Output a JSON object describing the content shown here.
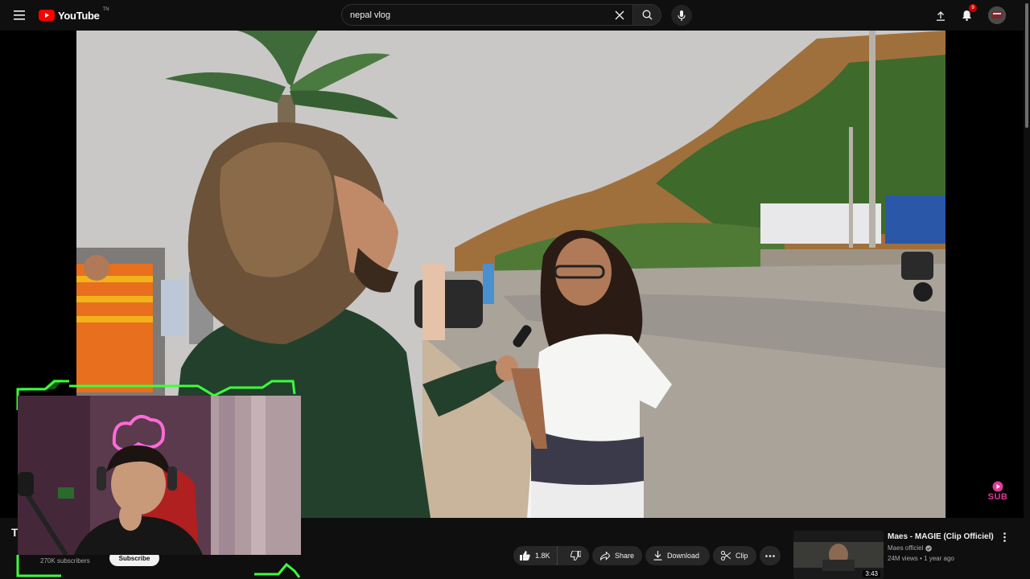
{
  "header": {
    "logo_text": "YouTube",
    "logo_sup": "TN",
    "search": {
      "value": "nepal vlog",
      "placeholder": "Search"
    },
    "notifications_count": "9"
  },
  "video": {
    "title_visible": "T",
    "channel_subscribers": "270K subscribers",
    "subscribe_label": "Subscribe",
    "likes": "1.8K",
    "actions": {
      "share": "Share",
      "download": "Download",
      "clip": "Clip"
    },
    "watermark": "SUB"
  },
  "recommendation": {
    "title": "Maes - MAGIE (Clip Officiel)",
    "channel": "Maes officiel",
    "views": "24M views",
    "age": "1 year ago",
    "duration": "3:43"
  },
  "colors": {
    "brand_red": "#ff0000",
    "overlay_green": "#3cff3c",
    "badge_red": "#cc0000"
  },
  "icons": [
    "menu-icon",
    "youtube-logo-icon",
    "close-icon",
    "search-icon",
    "mic-icon",
    "upload-icon",
    "bell-icon",
    "like-icon",
    "dislike-icon",
    "share-icon",
    "download-icon",
    "scissors-icon",
    "more-icon",
    "verified-icon",
    "more-vertical-icon"
  ]
}
